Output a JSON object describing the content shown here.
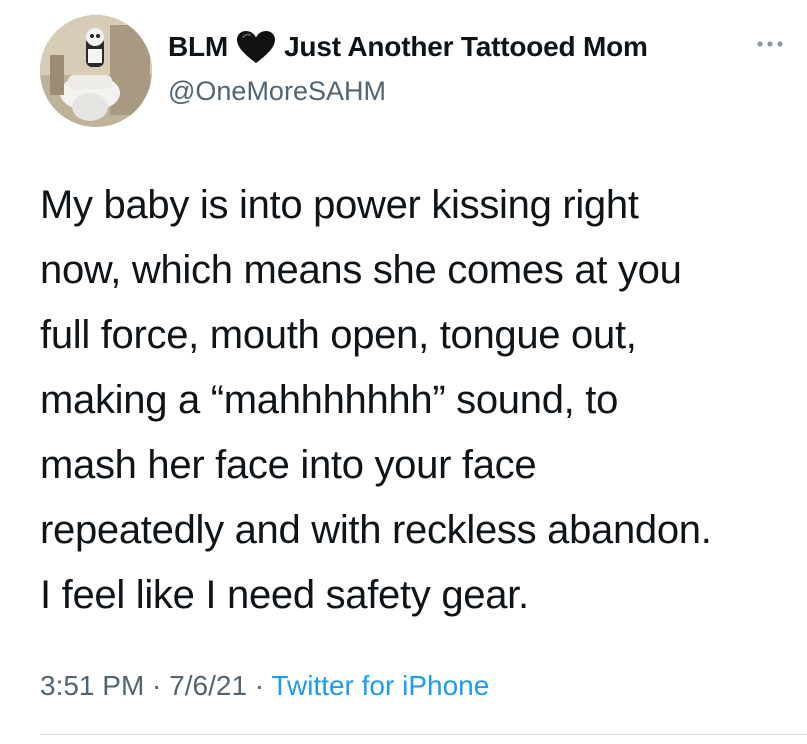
{
  "author": {
    "name_before_emoji": "BLM",
    "name_after_emoji": "Just Another Tattooed Mom",
    "emoji_icon": "black-heart-icon",
    "handle": "@OneMoreSAHM",
    "avatar_icon": "profile-avatar"
  },
  "more_menu": {
    "icon": "more-options-icon"
  },
  "tweet": {
    "lines": [
      "My baby is into power kissing right",
      "now, which means she comes at you",
      "full force, mouth open, tongue out,",
      "making a “mahhhhhhh” sound, to",
      "mash her face into your face",
      "repeatedly and with reckless abandon.",
      "I feel like I need safety gear."
    ]
  },
  "meta": {
    "time": "3:51 PM",
    "separator": " · ",
    "date": "7/6/21",
    "source": "Twitter for iPhone"
  },
  "colors": {
    "text": "#0f1419",
    "secondary": "#536471",
    "link": "#1d9bf0",
    "divider": "#cfd9de"
  }
}
